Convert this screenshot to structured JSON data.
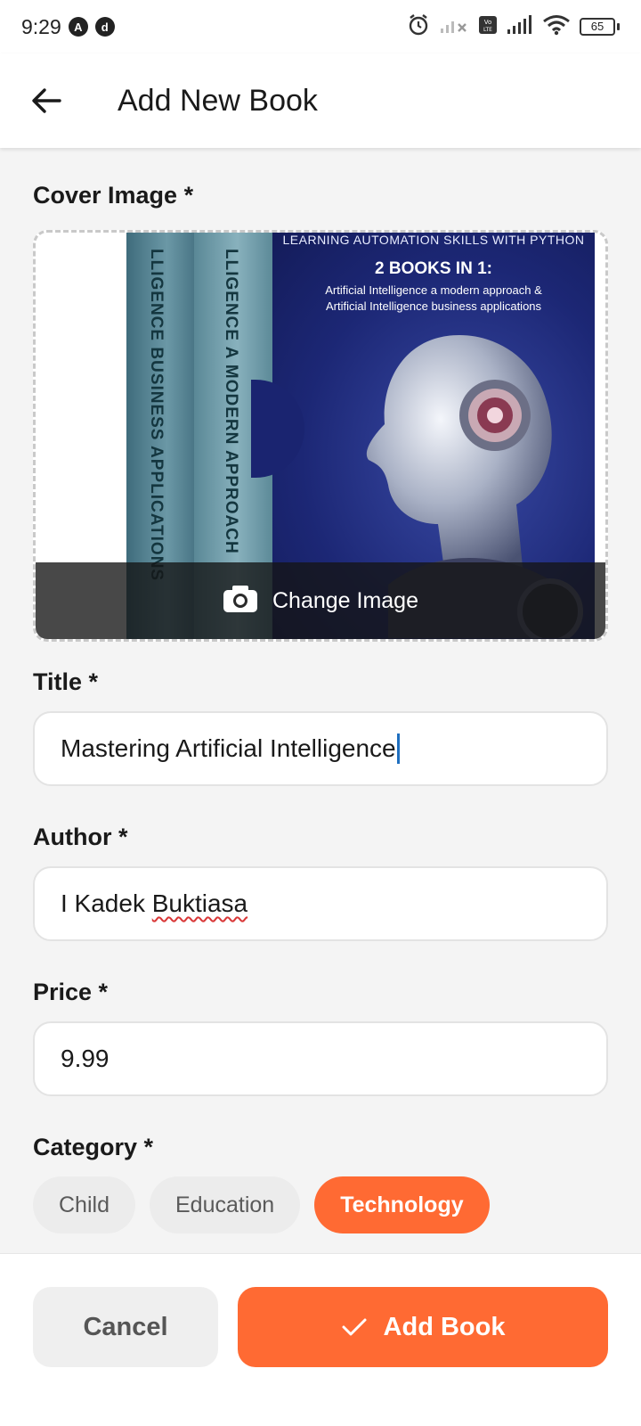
{
  "status_bar": {
    "time": "9:29",
    "notification_icons": [
      "A",
      "d"
    ],
    "battery_level": "65"
  },
  "app_bar": {
    "title": "Add New Book",
    "back_icon": "arrow-left-icon"
  },
  "form": {
    "cover_label": "Cover Image *",
    "cover_image": {
      "top_tagline": "LEARNING AUTOMATION SKILLS WITH PYTHON",
      "headline": "2 BOOKS IN 1:",
      "subline_1": "Artificial Intelligence a modern approach &",
      "subline_2": "Artificial Intelligence business applications",
      "spine_1": "LLIGENCE BUSINESS APPLICATIONS",
      "spine_2": "LLIGENCE A MODERN APPROACH"
    },
    "change_image_label": "Change Image",
    "title_label": "Title *",
    "title_value": "Mastering Artificial Intelligence",
    "author_label": "Author *",
    "author_first": "I Kadek ",
    "author_underlined": "Buktiasa",
    "price_label": "Price *",
    "price_value": "9.99",
    "category_label": "Category *",
    "categories": [
      {
        "label": "Child",
        "selected": false
      },
      {
        "label": "Education",
        "selected": false
      },
      {
        "label": "Technology",
        "selected": true
      }
    ]
  },
  "actions": {
    "cancel_label": "Cancel",
    "add_label": "Add Book"
  },
  "colors": {
    "accent": "#ff6a33",
    "background": "#f4f4f4"
  }
}
